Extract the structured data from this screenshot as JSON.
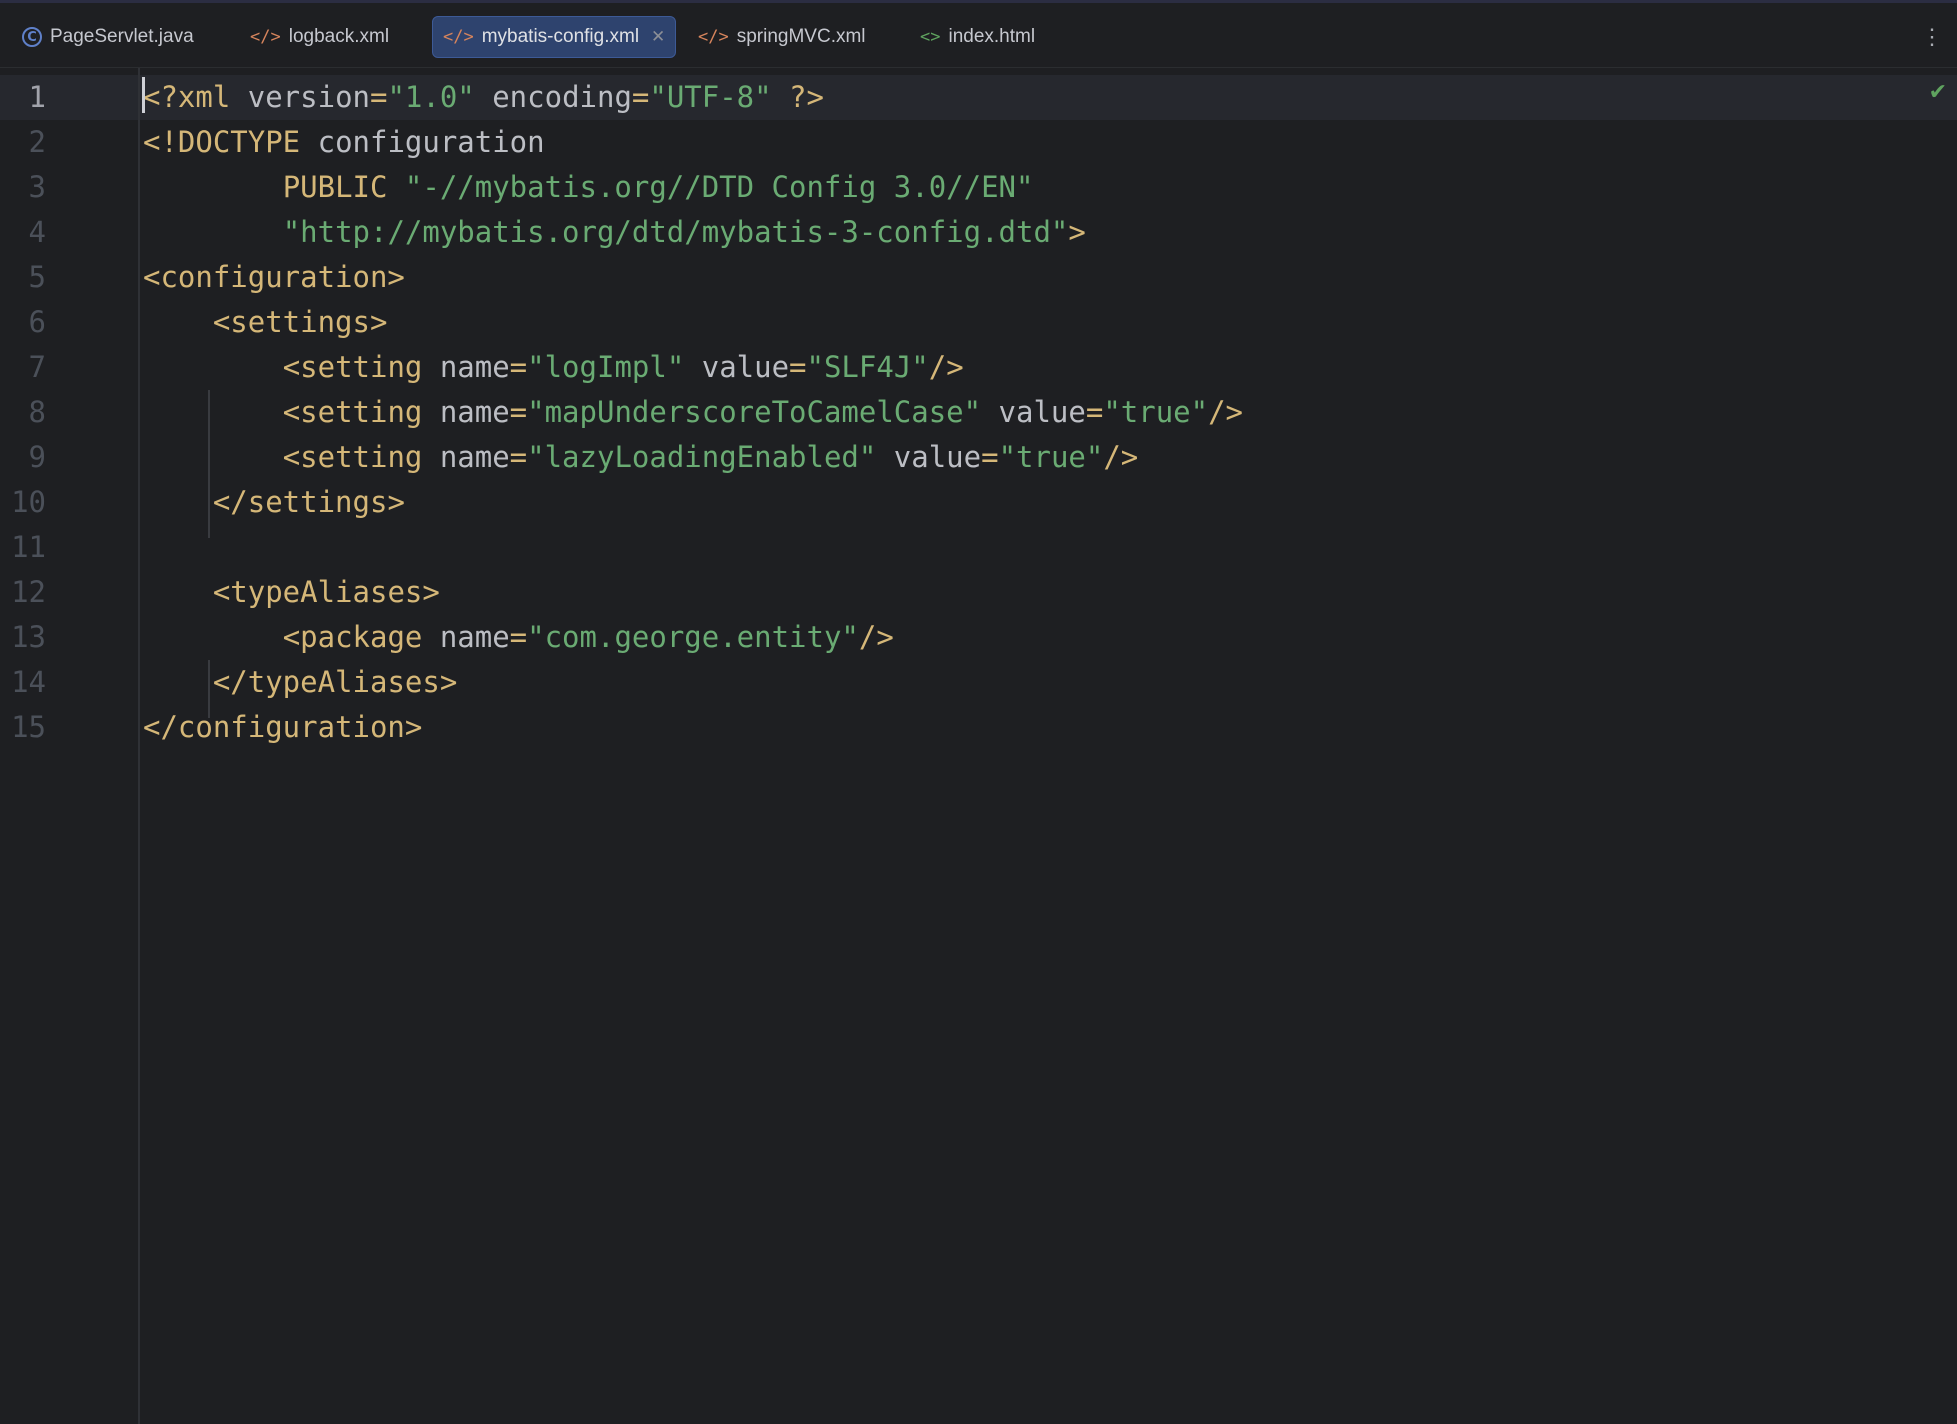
{
  "tabs": [
    {
      "label": "PageServlet.java",
      "icon": "java-class-icon",
      "active": false
    },
    {
      "label": "logback.xml",
      "icon": "xml-file-icon",
      "active": false
    },
    {
      "label": "mybatis-config.xml",
      "icon": "xml-file-icon",
      "active": true
    },
    {
      "label": "springMVC.xml",
      "icon": "spring-xml-icon",
      "active": false
    },
    {
      "label": "index.html",
      "icon": "html-file-icon",
      "active": false
    }
  ],
  "editor": {
    "current_line": 1,
    "inspection_status": "ok-check-icon",
    "lines": [
      {
        "n": "1",
        "tokens": [
          [
            "tag",
            "<?xml "
          ],
          [
            "attr",
            "version"
          ],
          [
            "tag",
            "="
          ],
          [
            "str",
            "\"1.0\""
          ],
          [
            "attr",
            " encoding"
          ],
          [
            "tag",
            "="
          ],
          [
            "str",
            "\"UTF-8\""
          ],
          [
            "tag",
            " ?>"
          ]
        ]
      },
      {
        "n": "2",
        "tokens": [
          [
            "tag",
            "<!DOCTYPE "
          ],
          [
            "plain",
            "configuration"
          ]
        ]
      },
      {
        "n": "3",
        "tokens": [
          [
            "plain",
            "        "
          ],
          [
            "tag",
            "PUBLIC "
          ],
          [
            "str",
            "\"-//mybatis.org//DTD Config 3.0//EN\""
          ]
        ]
      },
      {
        "n": "4",
        "tokens": [
          [
            "plain",
            "        "
          ],
          [
            "str",
            "\"http://mybatis.org/dtd/mybatis-3-config.dtd\""
          ],
          [
            "tag",
            ">"
          ]
        ]
      },
      {
        "n": "5",
        "tokens": [
          [
            "tag",
            "<configuration>"
          ]
        ]
      },
      {
        "n": "6",
        "tokens": [
          [
            "plain",
            "    "
          ],
          [
            "tag",
            "<settings>"
          ]
        ]
      },
      {
        "n": "7",
        "tokens": [
          [
            "plain",
            "        "
          ],
          [
            "tag",
            "<setting "
          ],
          [
            "attr",
            "name"
          ],
          [
            "tag",
            "="
          ],
          [
            "str",
            "\"logImpl\""
          ],
          [
            "attr",
            " value"
          ],
          [
            "tag",
            "="
          ],
          [
            "str",
            "\"SLF4J\""
          ],
          [
            "tag",
            "/>"
          ]
        ]
      },
      {
        "n": "8",
        "tokens": [
          [
            "plain",
            "        "
          ],
          [
            "tag",
            "<setting "
          ],
          [
            "attr",
            "name"
          ],
          [
            "tag",
            "="
          ],
          [
            "str",
            "\"mapUnderscoreToCamelCase\""
          ],
          [
            "attr",
            " value"
          ],
          [
            "tag",
            "="
          ],
          [
            "str",
            "\"true\""
          ],
          [
            "tag",
            "/>"
          ]
        ]
      },
      {
        "n": "9",
        "tokens": [
          [
            "plain",
            "        "
          ],
          [
            "tag",
            "<setting "
          ],
          [
            "attr",
            "name"
          ],
          [
            "tag",
            "="
          ],
          [
            "str",
            "\"lazyLoadingEnabled\""
          ],
          [
            "attr",
            " value"
          ],
          [
            "tag",
            "="
          ],
          [
            "str",
            "\"true\""
          ],
          [
            "tag",
            "/>"
          ]
        ]
      },
      {
        "n": "10",
        "tokens": [
          [
            "plain",
            "    "
          ],
          [
            "tag",
            "</settings>"
          ]
        ]
      },
      {
        "n": "11",
        "tokens": []
      },
      {
        "n": "12",
        "tokens": [
          [
            "plain",
            "    "
          ],
          [
            "tag",
            "<typeAliases>"
          ]
        ]
      },
      {
        "n": "13",
        "tokens": [
          [
            "plain",
            "        "
          ],
          [
            "tag",
            "<package "
          ],
          [
            "attr",
            "name"
          ],
          [
            "tag",
            "="
          ],
          [
            "str",
            "\"com.george.entity\""
          ],
          [
            "tag",
            "/>"
          ]
        ]
      },
      {
        "n": "14",
        "tokens": [
          [
            "plain",
            "    "
          ],
          [
            "tag",
            "</typeAliases>"
          ]
        ]
      },
      {
        "n": "15",
        "tokens": [
          [
            "tag",
            "</configuration>"
          ]
        ]
      }
    ]
  }
}
